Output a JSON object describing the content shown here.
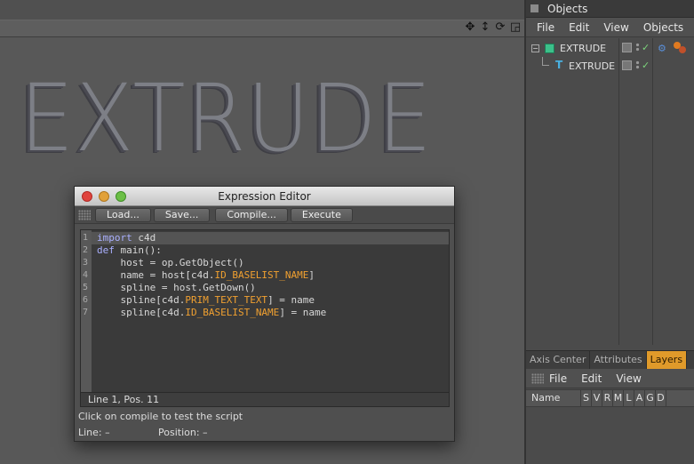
{
  "viewport": {
    "text_object": "EXTRUDE",
    "nav_icons": [
      "move-icon",
      "zoom-icon",
      "rotate-icon",
      "maximize-icon"
    ]
  },
  "objects_panel": {
    "title": "Objects",
    "menu": [
      "File",
      "Edit",
      "View",
      "Objects"
    ],
    "rows": [
      {
        "name": "EXTRUDE",
        "icon": "extrude-cube-icon",
        "expander": "−"
      },
      {
        "name": "EXTRUDE",
        "icon": "text-spline-icon"
      }
    ],
    "check": "✓"
  },
  "attributes_panel": {
    "tabs": [
      "Axis Center",
      "Attributes",
      "Layers"
    ],
    "active_tab": "Layers",
    "menu": [
      "File",
      "Edit",
      "View"
    ],
    "columns": {
      "name": "Name",
      "flags": [
        "S",
        "V",
        "R",
        "M",
        "L",
        "A",
        "G",
        "D"
      ]
    }
  },
  "editor": {
    "title": "Expression Editor",
    "buttons": {
      "load": "Load...",
      "save": "Save...",
      "compile": "Compile...",
      "execute": "Execute"
    },
    "line_numbers": [
      "1",
      "2",
      "3",
      "4",
      "5",
      "6",
      "7"
    ],
    "code": [
      [
        "import",
        " c4d"
      ],
      [
        "def",
        " main():"
      ],
      [
        "    host = op.GetObject()"
      ],
      [
        "    name = host[c4d.",
        "ID_BASELIST_NAME",
        "]"
      ],
      [
        "    spline = host.GetDown()"
      ],
      [
        "    spline[c4d.",
        "PRIM_TEXT_TEXT",
        "] = name"
      ],
      [
        "    spline[c4d.",
        "ID_BASELIST_NAME",
        "] = name"
      ]
    ],
    "cursor_status": "Line 1, Pos. 11",
    "hint": "Click on compile to test the script",
    "line_label": "Line:",
    "line_value": "–",
    "position_label": "Position:",
    "position_value": "–"
  },
  "colors": {
    "accent_tab": "#e09a2a",
    "keyword": "#aab0ff",
    "constant": "#f0a030"
  }
}
